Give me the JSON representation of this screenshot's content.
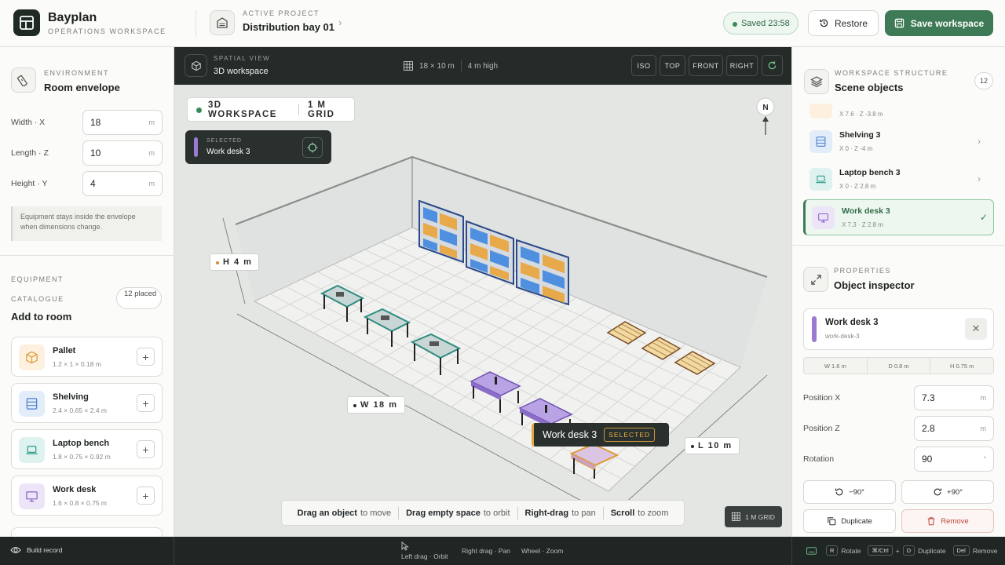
{
  "header": {
    "app_name": "Bayplan",
    "app_subtitle": "OPERATIONS WORKSPACE",
    "project_key": "ACTIVE PROJECT",
    "project_name": "Distribution bay 01",
    "saved": "Saved 23:58",
    "restore": "Restore",
    "save_workspace": "Save workspace"
  },
  "environment": {
    "key": "ENVIRONMENT",
    "title": "Room envelope",
    "fields": [
      {
        "label": "Width · X",
        "value": "18",
        "unit": "m"
      },
      {
        "label": "Length · Z",
        "value": "10",
        "unit": "m"
      },
      {
        "label": "Height · Y",
        "value": "4",
        "unit": "m"
      }
    ],
    "note": "Equipment stays inside the envelope when dimensions change."
  },
  "equipment": {
    "key1": "EQUIPMENT",
    "key2": "CATALOGUE",
    "title": "Add to room",
    "placed": "12 placed",
    "items": [
      {
        "name": "Pallet",
        "dims": "1.2 × 1 × 0.18 m",
        "icon": "box-icon",
        "color": "#f3a640"
      },
      {
        "name": "Shelving",
        "dims": "2.4 × 0.65 × 2.4 m",
        "icon": "shelving-icon",
        "color": "#4a7fd0"
      },
      {
        "name": "Laptop bench",
        "dims": "1.8 × 0.75 × 0.92 m",
        "icon": "laptop-icon",
        "color": "#2f9a8c"
      },
      {
        "name": "Work desk",
        "dims": "1.6 × 0.8 × 0.75 m",
        "icon": "monitor-icon",
        "color": "#8a63c9"
      }
    ]
  },
  "viewport": {
    "key": "SPATIAL VIEW",
    "title": "3D workspace",
    "room_dims": "18 × 10 m",
    "height": "4 m high",
    "views": [
      "ISO",
      "TOP",
      "FRONT",
      "RIGHT"
    ],
    "chip_mode": "3D WORKSPACE",
    "chip_grid": "1 M GRID",
    "selected_key": "SELECTED",
    "selected_name": "Work desk 3",
    "compass": "N",
    "dim_h": "H 4 m",
    "dim_w": "W 18 m",
    "dim_l": "L 10 m",
    "floating_label": "Work desk 3",
    "floating_tag": "SELECTED",
    "grid_tag": "1 M GRID",
    "help": [
      {
        "bold": "Drag an object",
        "text": "to move"
      },
      {
        "bold": "Drag empty space",
        "text": "to orbit"
      },
      {
        "bold": "Right-drag",
        "text": "to pan"
      },
      {
        "bold": "Scroll",
        "text": "to zoom"
      }
    ]
  },
  "structure": {
    "key": "WORKSPACE STRUCTURE",
    "title": "Scene objects",
    "count": "12",
    "partial_coords": "X 7.6 · Z -3.8 m",
    "objects": [
      {
        "name": "Shelving 3",
        "coords": "X 0 · Z -4 m"
      },
      {
        "name": "Laptop bench 3",
        "coords": "X 0 · Z 2.8 m"
      },
      {
        "name": "Work desk 3",
        "coords": "X 7.3 · Z 2.8 m"
      }
    ]
  },
  "inspector": {
    "key": "PROPERTIES",
    "title": "Object inspector",
    "name": "Work desk 3",
    "id": "work-desk-3",
    "dims": [
      "W 1.6 m",
      "D 0.8 m",
      "H 0.75 m"
    ],
    "fields": [
      {
        "label": "Position X",
        "value": "7.3",
        "unit": "m"
      },
      {
        "label": "Position Z",
        "value": "2.8",
        "unit": "m"
      },
      {
        "label": "Rotation",
        "value": "90",
        "unit": "°"
      }
    ],
    "rot_minus": "−90°",
    "rot_plus": "+90°",
    "duplicate": "Duplicate",
    "remove": "Remove"
  },
  "footer": {
    "build_record": "Build record",
    "left_drag": "Left drag · Orbit",
    "right_drag": "Right drag · Pan",
    "wheel": "Wheel · Zoom",
    "k_r": "R",
    "rotate": "Rotate",
    "k_ctrl": "⌘/Ctrl",
    "plus": "+",
    "k_d": "D",
    "duplicate": "Duplicate",
    "k_del": "Del",
    "remove": "Remove"
  }
}
